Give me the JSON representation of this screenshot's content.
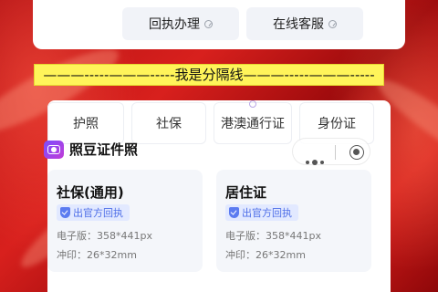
{
  "top_services": [
    {
      "label": "回执办理"
    },
    {
      "label": "在线客服"
    }
  ],
  "divider_text": "———-----———-----我是分隔线———-----———-----",
  "id_types": [
    "护照",
    "社保",
    "港澳通行证",
    "身份证"
  ],
  "brand": {
    "name": "照豆证件照"
  },
  "cards": [
    {
      "title": "社保(通用)",
      "badge": "出官方回执",
      "spec_digital": "电子版：358*441px",
      "spec_print": "冲印：26*32mm"
    },
    {
      "title": "居住证",
      "badge": "出官方回执",
      "spec_digital": "电子版：358*441px",
      "spec_print": "冲印：26*32mm"
    }
  ],
  "colors": {
    "background_red": "#c41815",
    "divider_yellow": "#fff45a",
    "badge_blue": "#4f6fe8"
  }
}
